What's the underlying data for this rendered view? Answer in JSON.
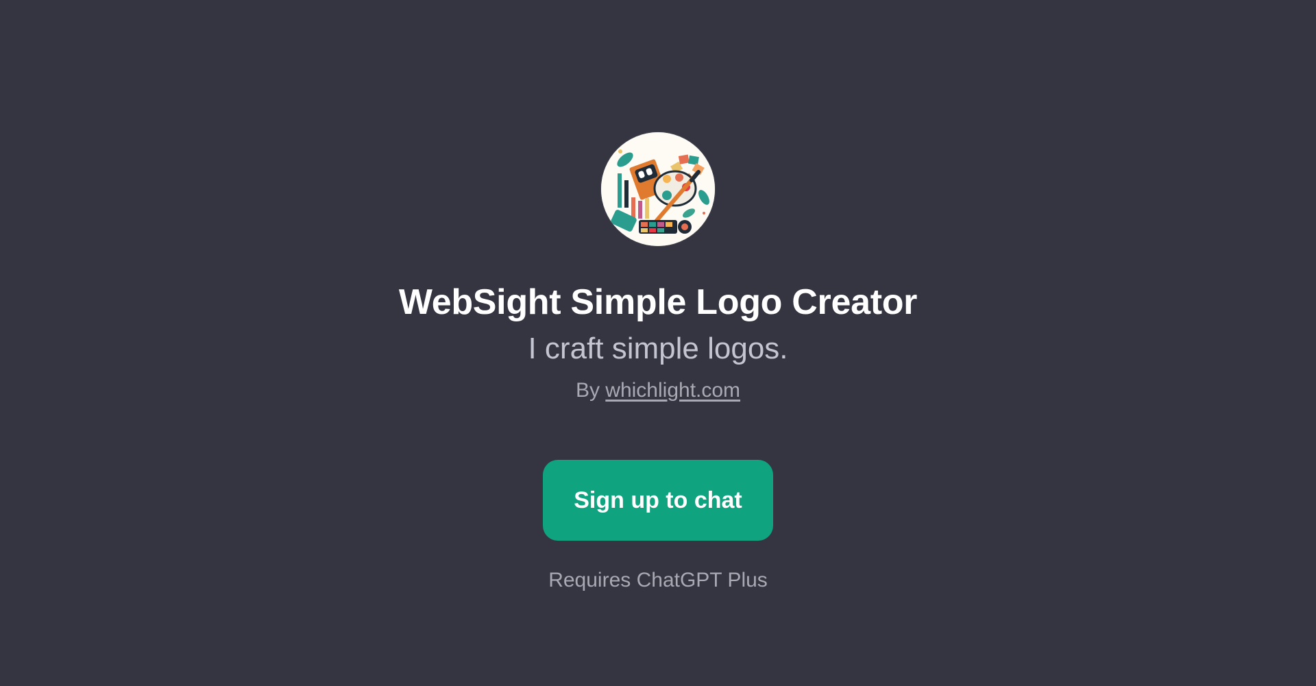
{
  "gpt": {
    "title": "WebSight Simple Logo Creator",
    "tagline": "I craft simple logos.",
    "by_prefix": "By",
    "author_link": "whichlight.com",
    "avatar_icon": "art-supplies-logo-icon"
  },
  "actions": {
    "signup_label": "Sign up to chat",
    "requirement": "Requires ChatGPT Plus"
  },
  "colors": {
    "background": "#343541",
    "button": "#10a37f",
    "title": "#ffffff",
    "muted": "#a9a9b3"
  }
}
